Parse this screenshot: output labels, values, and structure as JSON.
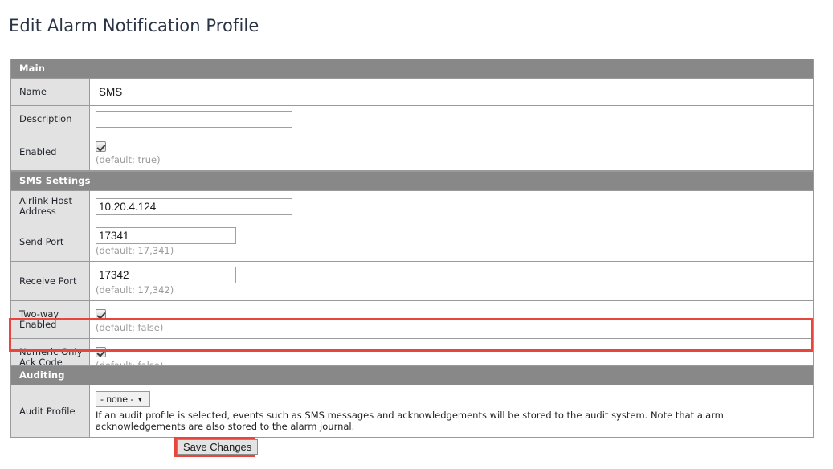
{
  "page": {
    "title": "Edit Alarm Notification Profile"
  },
  "colors": {
    "section_header_bg": "#888888",
    "label_cell_bg": "#e2e2e2",
    "annotation_red": "#e8453c",
    "title_text": "#2b3445",
    "hint_text": "#9b9b9b"
  },
  "sections": {
    "main": {
      "header": "Main",
      "rows": {
        "name": {
          "label": "Name",
          "value": "SMS",
          "placeholder": ""
        },
        "description": {
          "label": "Description",
          "value": "",
          "placeholder": ""
        },
        "enabled": {
          "label": "Enabled",
          "checked": true,
          "hint": "(default: true)"
        }
      }
    },
    "sms_settings": {
      "header": "SMS Settings",
      "rows": {
        "airlink_host_address": {
          "label": "Airlink Host Address",
          "value": "10.20.4.124",
          "placeholder": ""
        },
        "send_port": {
          "label": "Send Port",
          "value": "17341",
          "hint": "(default: 17,341)"
        },
        "receive_port": {
          "label": "Receive Port",
          "value": "17342",
          "hint": "(default: 17,342)"
        },
        "two_way_enabled": {
          "label": "Two-way Enabled",
          "checked": true,
          "hint": "(default: false)"
        },
        "numeric_only_ack_code": {
          "label": "Numeric Only Ack Code",
          "checked": true,
          "hint": "(default: false)",
          "highlighted": true
        }
      }
    },
    "auditing": {
      "header": "Auditing",
      "rows": {
        "audit_profile": {
          "label": "Audit Profile",
          "selected": "- none -",
          "caret": "▼",
          "options": [
            "- none -"
          ],
          "description": "If an audit profile is selected, events such as SMS messages and acknowledgements will be stored to the audit system. Note that alarm acknowledgements are also stored to the alarm journal."
        }
      }
    }
  },
  "footer": {
    "save_label": "Save Changes",
    "save_highlighted": true
  }
}
